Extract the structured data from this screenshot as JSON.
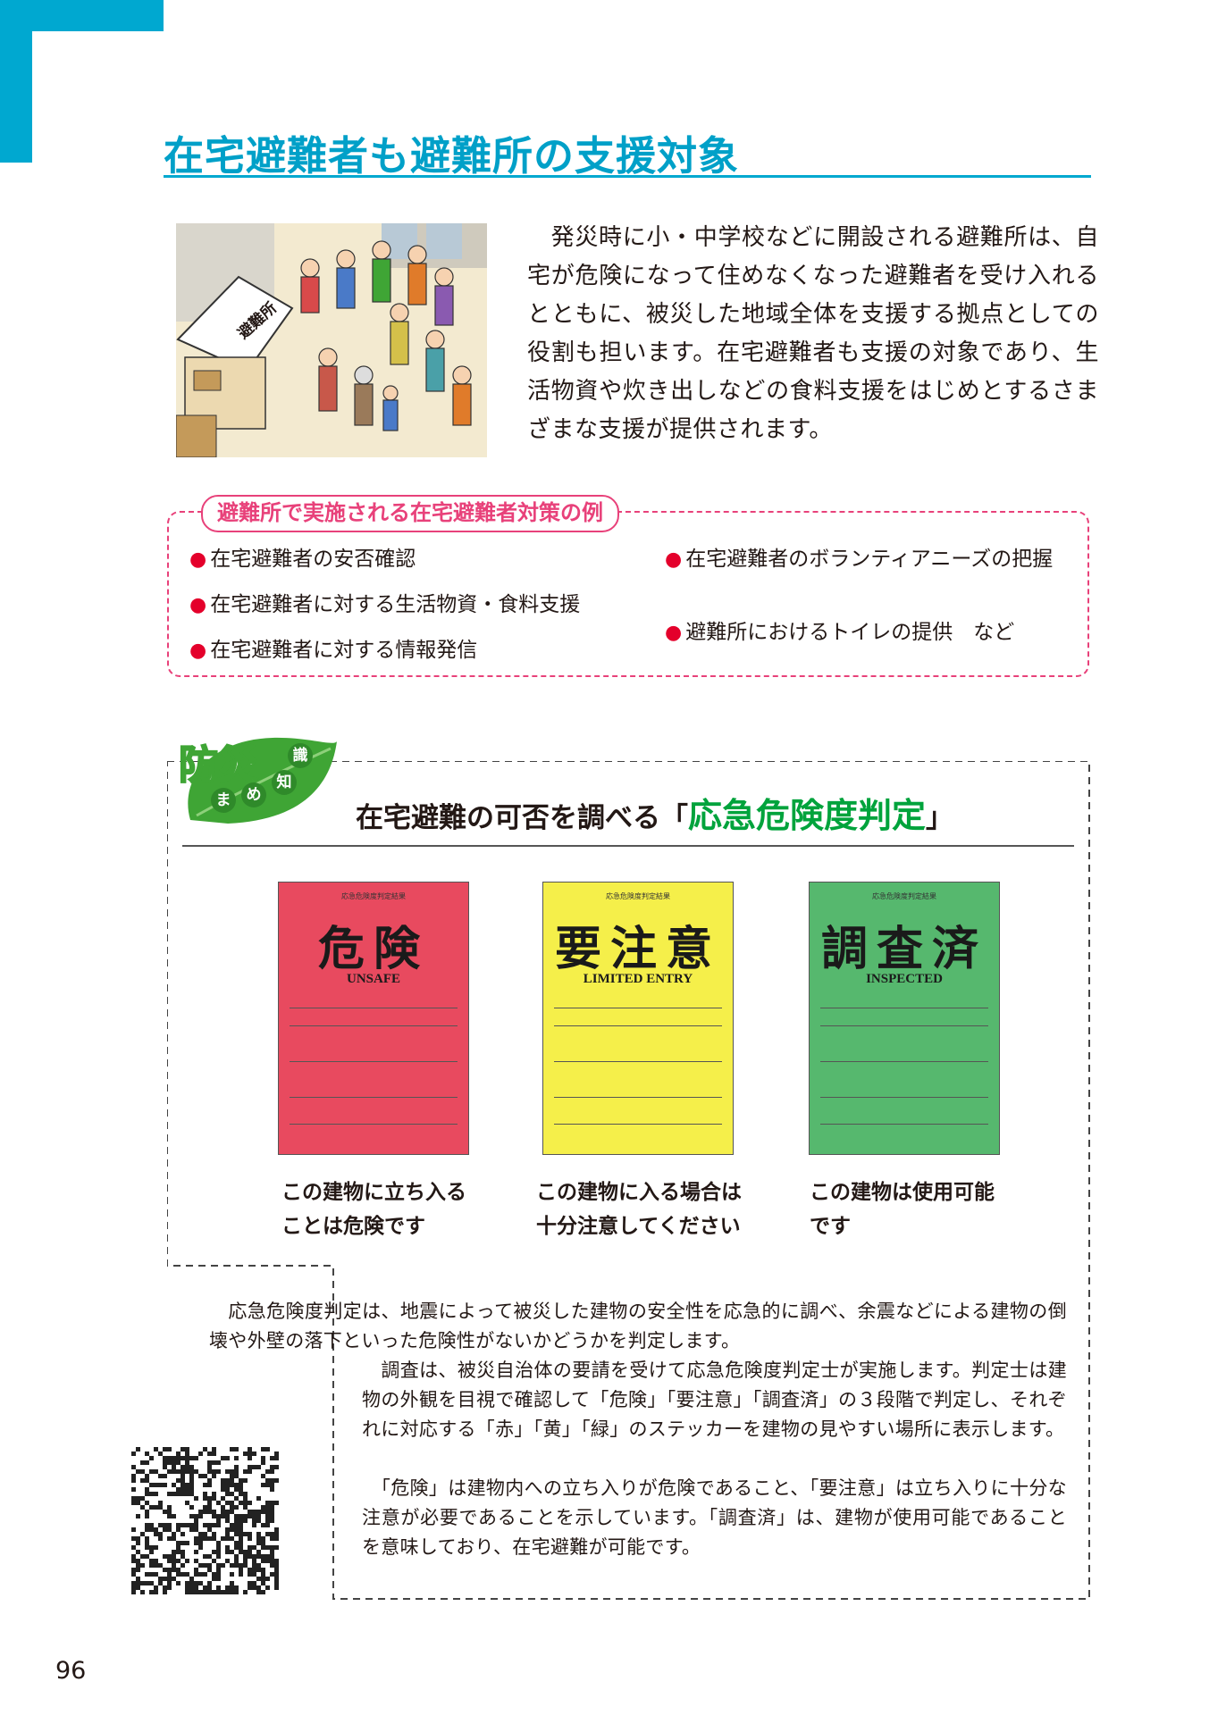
{
  "page_title": "在宅避難者も避難所の支援対象",
  "illustration_sign": "避難所",
  "intro_text": "　発災時に小・中学校などに開設される避難所は、自宅が危険になって住めなくなった避難者を受け入れるとともに、被災した地域全体を支援する拠点としての役割も担います。在宅避難者も支援の対象であり、生活物資や炊き出しなどの食料支援をはじめとするさまざまな支援が提供されます。",
  "measures": {
    "label": "避難所で実施される在宅避難者対策の例",
    "left": [
      "在宅避難者の安否確認",
      "在宅避難者に対する生活物資・食料支援",
      "在宅避難者に対する情報発信"
    ],
    "right": [
      "在宅避難者のボランティアニーズの把握",
      "避難所におけるトイレの提供　など"
    ],
    "bullet": "●"
  },
  "mamechishiki": {
    "badge_big": "防災",
    "badge_small": [
      "ま",
      "め",
      "知",
      "識"
    ],
    "heading_prefix": "在宅避難の可否を調べる「",
    "heading_highlight": "応急危険度判定",
    "heading_suffix": "」"
  },
  "stickers": [
    {
      "header": "応急危険度判定結果",
      "title": "危険",
      "english": "UNSAFE",
      "color": "#e84a5f",
      "caption": "この建物に立ち入ることは危険です"
    },
    {
      "header": "応急危険度判定結果",
      "title": "要注意",
      "english": "LIMITED ENTRY",
      "color": "#f5ef4a",
      "caption": "この建物に入る場合は十分注意してください"
    },
    {
      "header": "応急危険度判定結果",
      "title": "調査済",
      "english": "INSPECTED",
      "color": "#56b86e",
      "caption": "この建物は使用可能です"
    }
  ],
  "body_paragraphs": [
    "　応急危険度判定は、地震によって被災した建物の安全性を応急的に調べ、余震などによる建物の倒壊や外壁の落下といった危険性がないかどうかを判定します。",
    "　調査は、被災自治体の要請を受けて応急危険度判定士が実施します。判定士は建物の外観を目視で確認して「危険」「要注意」「調査済」の３段階で判定し、それぞれに対応する「赤」「黄」「緑」のステッカーを建物の見やすい場所に表示します。",
    "　「危険」は建物内への立ち入りが危険であること、「要注意」は立ち入りに十分な注意が必要であることを示しています。「調査済」は、建物が使用可能であることを意味しており、在宅避難が可能です。"
  ],
  "colors": {
    "accent_blue": "#00a8d0",
    "pink": "#e8417a",
    "bullet_red": "#e4002b",
    "leaf_green": "#3fa535",
    "highlight_green": "#00a33c"
  },
  "page_number": "96"
}
